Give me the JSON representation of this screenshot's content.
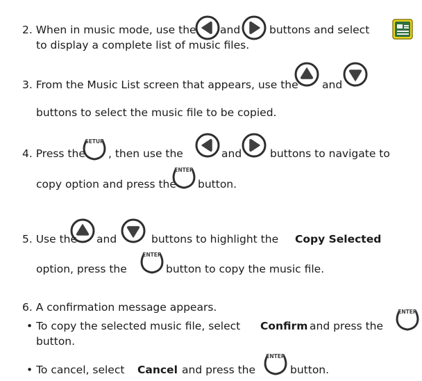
{
  "steps": {
    "s2": {
      "p1": "2. When in music mode, use the",
      "p2": "and",
      "p3": "buttons and  select",
      "p4": "to display a complete list of music files."
    },
    "s3": {
      "p1": "3. From the Music List screen that appears, use the",
      "p2": "and",
      "p3": "buttons to select the music file to be copied."
    },
    "s4": {
      "p1": "4. Press the",
      "p2": ", then use the",
      "p3": "and",
      "p4": "buttons to navigate to",
      "p5": "copy option and press the",
      "p6": "button."
    },
    "s5": {
      "p1": "5. Use the",
      "p2": "and",
      "p3": "buttons to highlight the",
      "p3b": "Copy Selected",
      "p4": "option, press the",
      "p5": "button to copy the music file."
    },
    "s6": {
      "p1": "6. A confirmation message appears.",
      "b1a": "• To copy the selected music file, select",
      "b1b": "Confirm",
      "b1c": "and press the",
      "b1d": "button.",
      "b2a": "• To cancel, select",
      "b2b": "Cancel",
      "b2c": "and press the",
      "b2d": "button."
    }
  },
  "buttons": {
    "setup_label": "SETUP",
    "enter_label": "ENTER",
    "stroke_color": "#2e2e2e",
    "icon_color": "#3f3f3f"
  },
  "list_icon": {
    "name": "music-list-icon",
    "bg_color": "#e8d21a",
    "screen_color": "#2e6f3e"
  }
}
